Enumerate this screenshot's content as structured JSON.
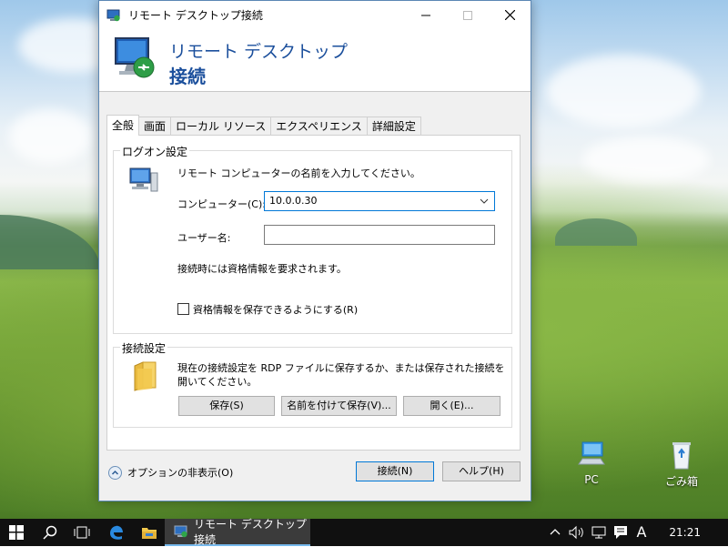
{
  "window": {
    "title": "リモート デスクトップ接続",
    "banner_line1": "リモート デスクトップ",
    "banner_line2": "接続"
  },
  "tabs": [
    "全般",
    "画面",
    "ローカル リソース",
    "エクスペリエンス",
    "詳細設定"
  ],
  "logon": {
    "legend": "ログオン設定",
    "prompt": "リモート コンピューターの名前を入力してください。",
    "computer_label": "コンピューター(C):",
    "computer_value": "10.0.0.30",
    "user_label": "ユーザー名:",
    "user_value": "",
    "info": "接続時には資格情報を要求されます。",
    "save_credentials_label": "資格情報を保存できるようにする(R)"
  },
  "connection": {
    "legend": "接続設定",
    "desc_line1": "現在の接続設定を RDP ファイルに保存するか、または保存された接続を",
    "desc_line2": "開いてください。",
    "save_button": "保存(S)",
    "save_as_button": "名前を付けて保存(V)...",
    "open_button": "開く(E)..."
  },
  "footer": {
    "options_label": "オプションの非表示(O)",
    "connect_button": "接続(N)",
    "help_button": "ヘルプ(H)"
  },
  "desktop": {
    "icons": [
      {
        "label": "PC",
        "icon": "computer-icon"
      },
      {
        "label": "ごみ箱",
        "icon": "recycle-bin-icon"
      }
    ]
  },
  "taskbar": {
    "active_app": "リモート デスクトップ接続",
    "ime": "A",
    "clock": "21:21"
  },
  "colors": {
    "accent": "#0078d7",
    "banner_text": "#1b4f9c",
    "taskbar": "#101010"
  }
}
